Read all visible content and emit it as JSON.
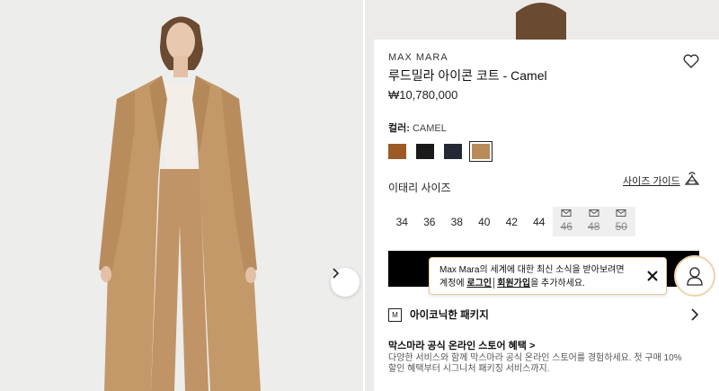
{
  "product": {
    "brand": "MAX MARA",
    "title": "루드밀라 아이콘 코트 - Camel",
    "price": "₩10,780,000"
  },
  "color": {
    "label": "컬러:",
    "selected": "CAMEL",
    "swatches": [
      {
        "name": "brown",
        "hex": "#9c5a26"
      },
      {
        "name": "black",
        "hex": "#1a1a1a"
      },
      {
        "name": "navy",
        "hex": "#232834"
      },
      {
        "name": "camel",
        "hex": "#b98a5a"
      }
    ]
  },
  "size": {
    "label": "이태리 사이즈",
    "guide_label": "사이즈 가이드",
    "options": [
      {
        "label": "34",
        "available": true
      },
      {
        "label": "36",
        "available": true
      },
      {
        "label": "38",
        "available": true
      },
      {
        "label": "40",
        "available": true
      },
      {
        "label": "42",
        "available": true
      },
      {
        "label": "44",
        "available": true
      },
      {
        "label": "46",
        "available": false
      },
      {
        "label": "48",
        "available": false
      },
      {
        "label": "50",
        "available": false
      }
    ]
  },
  "toast": {
    "line1": "Max Mara의 세계에 대한 최신 소식을 받아보려면",
    "line2_prefix": "계정에 ",
    "login": "로그인",
    "separator": "│",
    "signup": "회원가입",
    "line2_suffix": "을 추가하세요."
  },
  "package": {
    "icon_letter": "M",
    "label": "아이코닉한 패키지"
  },
  "promo": {
    "title": "막스마라 공식 온라인 스토어 혜택 >",
    "body": "다양한 서비스와 함께 막스마라 공식 온라인 스토어를 경험하세요. 첫 구매 10% 할인 혜택부터 시그니처 패키징 서비스까지."
  },
  "icons": {
    "wishlist": "heart-icon",
    "size_guide": "hanger-icon",
    "next": "chevron-right-icon",
    "close": "close-icon",
    "account": "user-icon",
    "notify": "mail-icon"
  }
}
